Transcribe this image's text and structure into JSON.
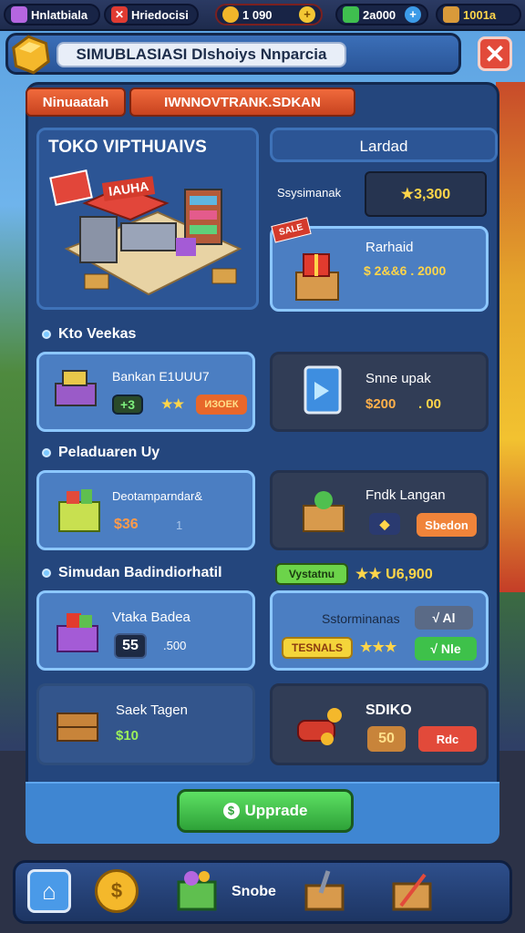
{
  "topbar": {
    "item1": "Hnlatbiala",
    "item2": "Hriedocisi",
    "coins": "1  090",
    "cash": "2a000",
    "gold": "1001a"
  },
  "header": {
    "title": "SIMUBLASIASI Dlshoiys Nnparcia",
    "close": "✕"
  },
  "tabs": [
    "Ninuaatah",
    "IWNNOVTRANK.SDKAN"
  ],
  "shop": {
    "title": "TOKO VIPTHUAIVS",
    "sign": "IAUHA"
  },
  "lardad": {
    "title": "Lardad",
    "label": "Ssysimanak",
    "value": "★3,300",
    "sale_tag": "SALE",
    "item_name": "Rarhaid",
    "item_price": "$ 2&&6 . 2000"
  },
  "sections": [
    {
      "label": "Kto Veekas"
    },
    {
      "label": "Peladuaren Uy"
    },
    {
      "label": "Simudan Badindiorhatil"
    }
  ],
  "items": [
    {
      "name": "Bankan E1UUU7",
      "tag": "+3",
      "badge": "ИЗОЕК"
    },
    {
      "name": "Snne upak",
      "price": "$200",
      "extra": ". 00"
    },
    {
      "name": "Deotamparndar&",
      "price": "$36",
      "extra": "1"
    },
    {
      "name": "Fndk Langan",
      "btn": "Sbedon"
    },
    {
      "name": "Vtaka Badea",
      "count": "55",
      "extra": ".500"
    },
    {
      "name": "Sstorminanas",
      "tag": "√ Al",
      "btn1": "TESNALS",
      "btn2": "√ Nle"
    },
    {
      "name": "Saek Tagen",
      "price": "$10"
    },
    {
      "name": "SDIKO",
      "num": "50",
      "btn": "Rdc"
    }
  ],
  "section3_badge": "Vystatnu",
  "section3_value": "★★ U6,900",
  "upgrade": "Upprade",
  "bottom": {
    "label": "Snobe"
  },
  "colors": {
    "accent": "#f06a3c",
    "upgrade": "#3ec146",
    "panel": "#24467d"
  }
}
